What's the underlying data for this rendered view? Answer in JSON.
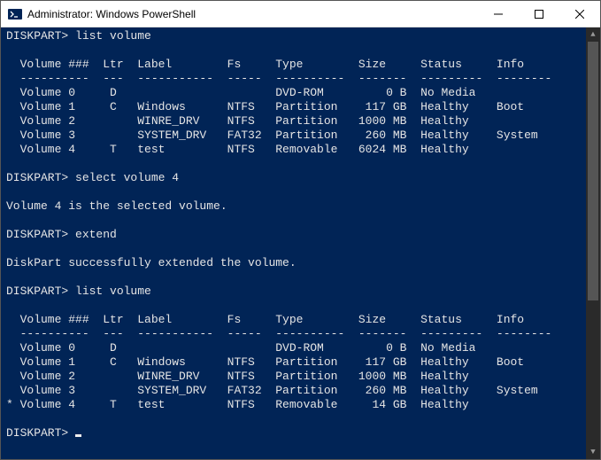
{
  "window": {
    "title": "Administrator: Windows PowerShell"
  },
  "prompts": {
    "diskpart": "DISKPART>"
  },
  "commands": {
    "list_volume": "list volume",
    "select_volume": "select volume 4",
    "extend": "extend"
  },
  "messages": {
    "selected": "Volume 4 is the selected volume.",
    "extended": "DiskPart successfully extended the volume."
  },
  "table_header": {
    "cols": [
      "Volume ###",
      "Ltr",
      "Label",
      "Fs",
      "Type",
      "Size",
      "Status",
      "Info"
    ],
    "dashes": [
      "----------",
      "---",
      "-----------",
      "-----",
      "----------",
      "-------",
      "---------",
      "--------"
    ]
  },
  "volumes_before": [
    {
      "mark": " ",
      "vol": "Volume 0",
      "ltr": "D",
      "label": "",
      "fs": "",
      "type": "DVD-ROM",
      "size": "0 B",
      "status": "No Media",
      "info": ""
    },
    {
      "mark": " ",
      "vol": "Volume 1",
      "ltr": "C",
      "label": "Windows",
      "fs": "NTFS",
      "type": "Partition",
      "size": "117 GB",
      "status": "Healthy",
      "info": "Boot"
    },
    {
      "mark": " ",
      "vol": "Volume 2",
      "ltr": "",
      "label": "WINRE_DRV",
      "fs": "NTFS",
      "type": "Partition",
      "size": "1000 MB",
      "status": "Healthy",
      "info": ""
    },
    {
      "mark": " ",
      "vol": "Volume 3",
      "ltr": "",
      "label": "SYSTEM_DRV",
      "fs": "FAT32",
      "type": "Partition",
      "size": "260 MB",
      "status": "Healthy",
      "info": "System"
    },
    {
      "mark": " ",
      "vol": "Volume 4",
      "ltr": "T",
      "label": "test",
      "fs": "NTFS",
      "type": "Removable",
      "size": "6024 MB",
      "status": "Healthy",
      "info": ""
    }
  ],
  "volumes_after": [
    {
      "mark": " ",
      "vol": "Volume 0",
      "ltr": "D",
      "label": "",
      "fs": "",
      "type": "DVD-ROM",
      "size": "0 B",
      "status": "No Media",
      "info": ""
    },
    {
      "mark": " ",
      "vol": "Volume 1",
      "ltr": "C",
      "label": "Windows",
      "fs": "NTFS",
      "type": "Partition",
      "size": "117 GB",
      "status": "Healthy",
      "info": "Boot"
    },
    {
      "mark": " ",
      "vol": "Volume 2",
      "ltr": "",
      "label": "WINRE_DRV",
      "fs": "NTFS",
      "type": "Partition",
      "size": "1000 MB",
      "status": "Healthy",
      "info": ""
    },
    {
      "mark": " ",
      "vol": "Volume 3",
      "ltr": "",
      "label": "SYSTEM_DRV",
      "fs": "FAT32",
      "type": "Partition",
      "size": "260 MB",
      "status": "Healthy",
      "info": "System"
    },
    {
      "mark": "*",
      "vol": "Volume 4",
      "ltr": "T",
      "label": "test",
      "fs": "NTFS",
      "type": "Removable",
      "size": "14 GB",
      "status": "Healthy",
      "info": ""
    }
  ]
}
